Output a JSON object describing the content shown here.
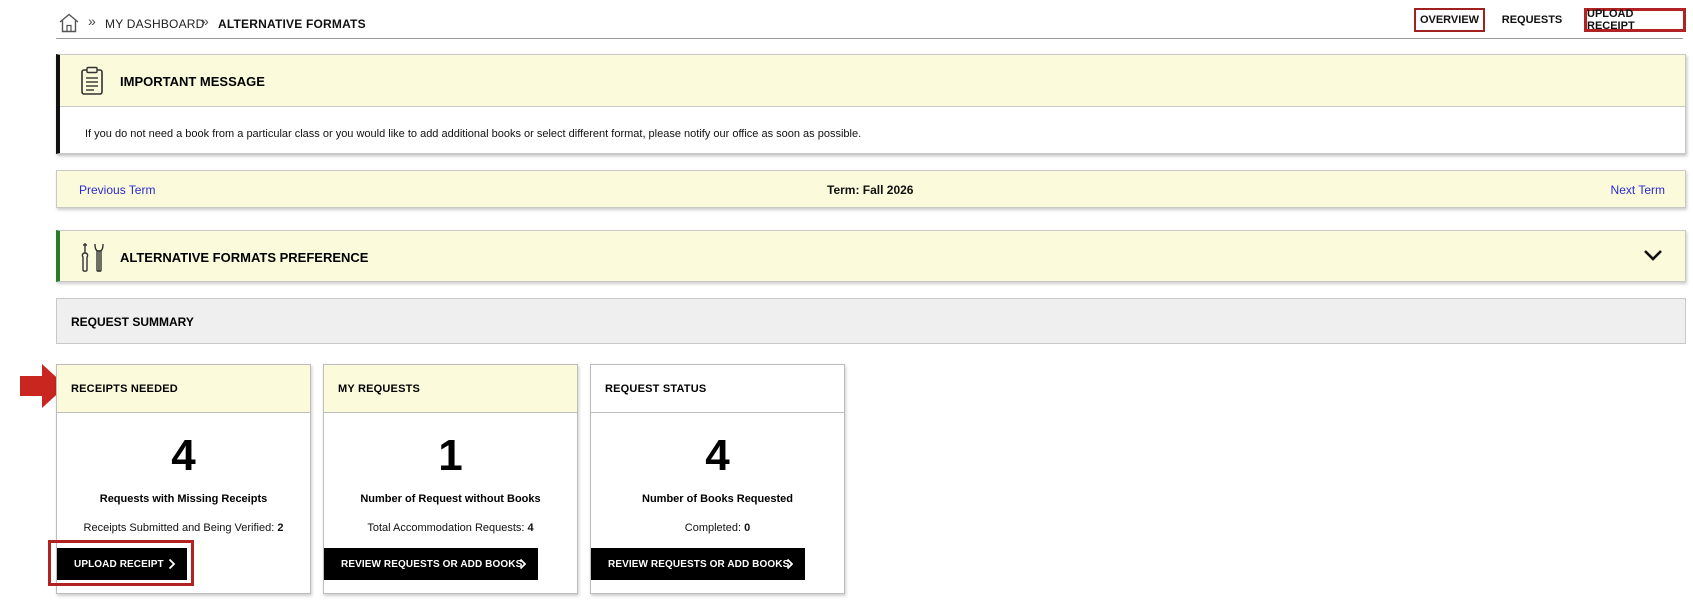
{
  "breadcrumb": {
    "home_icon": "home-icon",
    "separator": "»",
    "items": [
      "MY DASHBOARD",
      "ALTERNATIVE FORMATS"
    ]
  },
  "nav": {
    "overview": "OVERVIEW",
    "requests": "REQUESTS",
    "upload_receipt": "UPLOAD RECEIPT"
  },
  "message": {
    "icon": "clipboard-icon",
    "title": "IMPORTANT MESSAGE",
    "text": "If you do not need a book from a particular class or you would like to add additional books or select different format, please notify our office as soon as possible."
  },
  "term": {
    "previous": "Previous Term",
    "label": "Term: Fall 2026",
    "next": "Next Term"
  },
  "preference": {
    "icon": "tools-icon",
    "title": "ALTERNATIVE FORMATS PREFERENCE",
    "toggle_icon": "chevron-down-icon"
  },
  "summary": {
    "title": "REQUEST SUMMARY",
    "cards": [
      {
        "title": "RECEIPTS NEEDED",
        "number": "4",
        "label": "Requests with Missing Receipts",
        "sub_label": "Receipts Submitted and Being Verified:",
        "sub_value": "2",
        "button": "UPLOAD RECEIPT"
      },
      {
        "title": "MY REQUESTS",
        "number": "1",
        "label": "Number of Request without Books",
        "sub_label": "Total Accommodation Requests:",
        "sub_value": "4",
        "button": "REVIEW REQUESTS OR ADD BOOKS"
      },
      {
        "title": "REQUEST STATUS",
        "number": "4",
        "label": "Number of Books Requested",
        "sub_label": "Completed:",
        "sub_value": "0",
        "button": "REVIEW REQUESTS OR ADD BOOKS"
      }
    ]
  },
  "colors": {
    "highlight": "#b22222",
    "panel_yellow": "#fbfbdc",
    "link_blue": "#2a2ad0",
    "preference_accent": "#2a7a2a"
  }
}
